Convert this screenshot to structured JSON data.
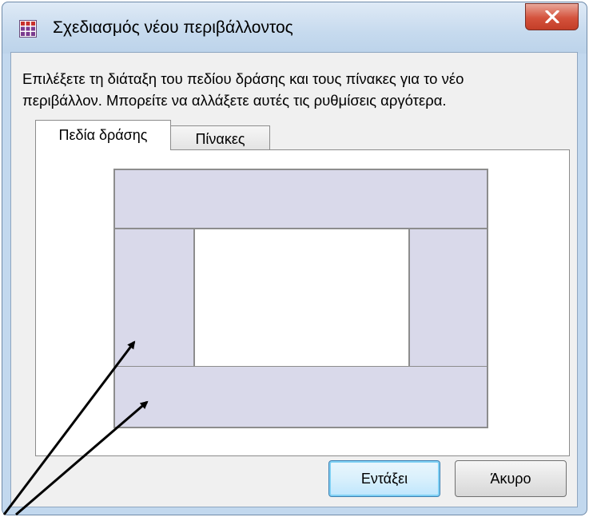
{
  "window": {
    "title": "Σχεδιασμός νέου περιβάλλοντος",
    "app_icon": "grid-icon",
    "close_icon": "close-icon"
  },
  "dialog": {
    "instruction_line1": "Επιλέξετε τη διάταξη του πεδίου δράσης και τους πίνακες για το νέο",
    "instruction_line2": "περιβάλλον. Μπορείτε να αλλάξετε αυτές τις ρυθμίσεις αργότερα."
  },
  "tabs": [
    {
      "label": "Πεδία δράσης",
      "selected": true
    },
    {
      "label": "Πίνακες",
      "selected": false
    }
  ],
  "buttons": {
    "ok_label": "Εντάξει",
    "cancel_label": "Άκυρο"
  },
  "colors": {
    "pane_fill": "#d9d9ea",
    "close_button": "#d4523c",
    "ok_button_border": "#3c7fb1"
  }
}
